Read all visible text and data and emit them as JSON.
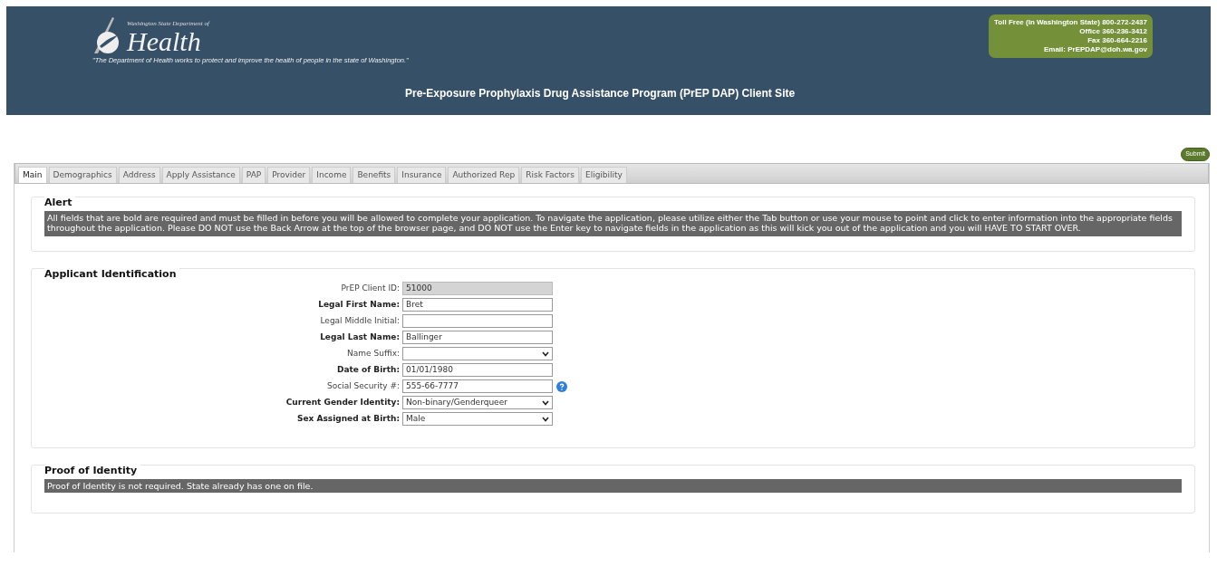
{
  "header": {
    "logo_small": "Washington State Department of",
    "logo_name": "Health",
    "motto": "\"The Department of Health works to protect and improve the health of people in the state of Washington.\"",
    "site_title": "Pre-Exposure Prophylaxis Drug Assistance Program (PrEP DAP) Client Site",
    "contact": [
      "Toll Free (In Washington State) 800-272-2437",
      "Office 360-236-3412",
      "Fax 360-664-2216",
      "Email: PrEPDAP@doh.wa.gov"
    ]
  },
  "submit_button": "Submit",
  "tabs": [
    {
      "label": "Main",
      "selected": true
    },
    {
      "label": "Demographics",
      "selected": false
    },
    {
      "label": "Address",
      "selected": false
    },
    {
      "label": "Apply Assistance",
      "selected": false
    },
    {
      "label": "PAP",
      "selected": false
    },
    {
      "label": "Provider",
      "selected": false
    },
    {
      "label": "Income",
      "selected": false
    },
    {
      "label": "Benefits",
      "selected": false
    },
    {
      "label": "Insurance",
      "selected": false
    },
    {
      "label": "Authorized Rep",
      "selected": false
    },
    {
      "label": "Risk Factors",
      "selected": false
    },
    {
      "label": "Eligibility",
      "selected": false
    }
  ],
  "alert": {
    "title": "Alert",
    "message": "All fields that are bold are required and must be filled in before you will be allowed to complete your application. To navigate the application, please utilize either the Tab button or use your mouse to point and click to enter information into the appropriate fields throughout the application. Please DO NOT use the Back Arrow at the top of the browser page, and DO NOT use the Enter key to navigate fields in the application as this will kick you out of the application and you will HAVE TO START OVER."
  },
  "applicant_identification": {
    "title": "Applicant Identification",
    "fields": [
      {
        "label": "PrEP Client ID:",
        "kind": "text",
        "value": "51000",
        "required": false,
        "disabled": true
      },
      {
        "label": "Legal First Name:",
        "kind": "text",
        "value": "Bret",
        "required": true,
        "disabled": false
      },
      {
        "label": "Legal Middle Initial:",
        "kind": "text",
        "required": false,
        "disabled": false
      },
      {
        "label": "Legal Last Name:",
        "kind": "text",
        "value": "Ballinger",
        "required": true,
        "disabled": false
      },
      {
        "label": "Name Suffix:",
        "kind": "select",
        "required": false,
        "disabled": false
      },
      {
        "label": "Date of Birth:",
        "kind": "text",
        "value": "01/01/1980",
        "required": true,
        "disabled": false
      },
      {
        "label": "Social Security #:",
        "kind": "text",
        "value": "555-66-7777",
        "required": false,
        "disabled": false,
        "help": true
      },
      {
        "label": "Current Gender Identity:",
        "kind": "select",
        "value": "Non-binary/Genderqueer",
        "required": true,
        "disabled": false
      },
      {
        "label": "Sex Assigned at Birth:",
        "kind": "select",
        "value": "Male",
        "required": true,
        "disabled": false
      }
    ]
  },
  "proof_of_identity": {
    "title": "Proof of Identity",
    "message": "Proof of Identity is not required. State already has one on file."
  }
}
